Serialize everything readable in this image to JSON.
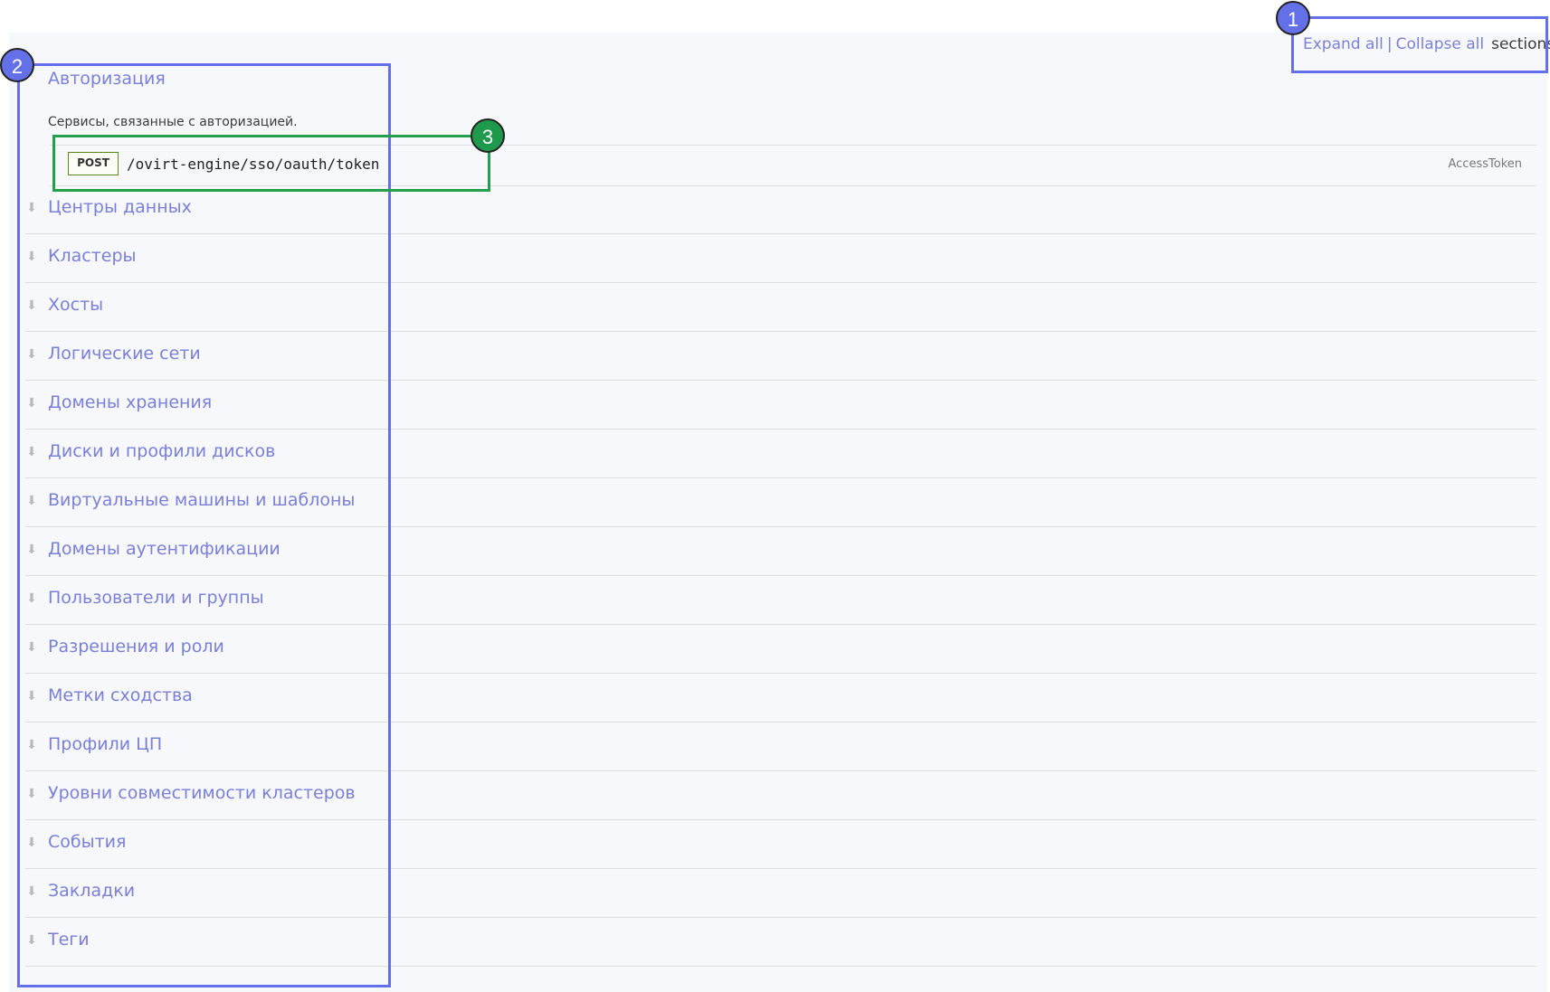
{
  "toolbar": {
    "expand_label": "Expand all",
    "separator": "|",
    "collapse_label": "Collapse all",
    "suffix": "sections"
  },
  "auth_section": {
    "title": "Авторизация",
    "description": "Сервисы, связанные с авторизацией.",
    "operation": {
      "method": "POST",
      "path": "/ovirt-engine/sso/oauth/token",
      "summary": "AccessToken"
    }
  },
  "collapse_arrow_icon": "down-arrow-icon",
  "sections": [
    {
      "title": "Центры данных"
    },
    {
      "title": "Кластеры"
    },
    {
      "title": "Хосты"
    },
    {
      "title": "Логические сети"
    },
    {
      "title": "Домены хранения"
    },
    {
      "title": "Диски и профили дисков"
    },
    {
      "title": "Виртуальные машины и шаблоны"
    },
    {
      "title": "Домены аутентификации"
    },
    {
      "title": "Пользователи и группы"
    },
    {
      "title": "Разрешения и роли"
    },
    {
      "title": "Метки сходства"
    },
    {
      "title": "Профили ЦП"
    },
    {
      "title": "Уровни совместимости кластеров"
    },
    {
      "title": "События"
    },
    {
      "title": "Закладки"
    },
    {
      "title": "Теги"
    }
  ],
  "annotations": [
    {
      "label": "1",
      "color": "#6470e8"
    },
    {
      "label": "2",
      "color": "#6470e8"
    },
    {
      "label": "3",
      "color": "#1f9a4c"
    }
  ],
  "colors": {
    "link": "#7a80d8",
    "background": "#f7f8fb",
    "post_border": "#5a8a1a"
  }
}
